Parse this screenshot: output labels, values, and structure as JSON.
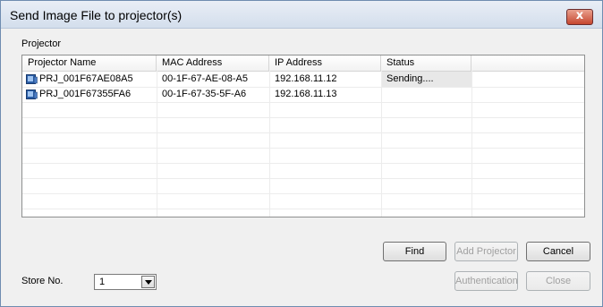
{
  "window": {
    "title": "Send Image File to projector(s)",
    "close_glyph": "x"
  },
  "group": {
    "label": "Projector"
  },
  "table": {
    "columns": [
      "Projector Name",
      "MAC Address",
      "IP Address",
      "Status"
    ],
    "rows": [
      {
        "name": "PRJ_001F67AE08A5",
        "mac": "00-1F-67-AE-08-A5",
        "ip": "192.168.11.12",
        "status": "Sending....",
        "icon": "projector-icon"
      },
      {
        "name": "PRJ_001F67355FA6",
        "mac": "00-1F-67-35-5F-A6",
        "ip": "192.168.11.13",
        "status": "",
        "icon": "projector-icon"
      }
    ]
  },
  "buttons": {
    "find": "Find",
    "add_projector": "Add Projector",
    "cancel": "Cancel",
    "authentication": "Authentication",
    "close": "Close"
  },
  "store": {
    "label": "Store No.",
    "value": "1"
  },
  "colors": {
    "titlebar": "#d3deec",
    "close_button": "#c6472f",
    "disabled_text": "#a0a0a0"
  }
}
